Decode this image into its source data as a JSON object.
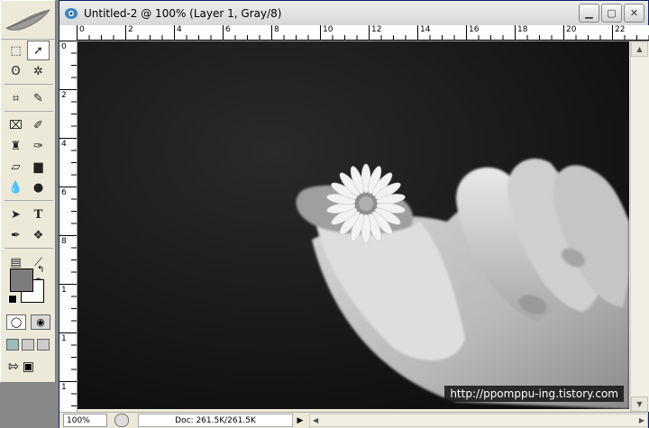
{
  "document": {
    "title": "Untitled-2 @ 100% (Layer 1, Gray/8)",
    "zoom": "100%",
    "doc_info": "Doc: 261.5K/261.5K",
    "watermark": "http://ppomppu-ing.tistory.com"
  },
  "ruler_h": [
    "0",
    "2",
    "4",
    "6",
    "8",
    "10",
    "12",
    "14",
    "16",
    "18",
    "20",
    "22"
  ],
  "ruler_v": [
    "0",
    "2",
    "4",
    "6",
    "8",
    "1",
    "1",
    "1",
    "1",
    "1",
    "1"
  ],
  "colors": {
    "foreground": "#7c7c7c",
    "background": "#ffffff"
  }
}
